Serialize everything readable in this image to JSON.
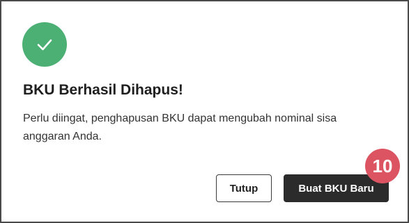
{
  "dialog": {
    "icon": "check-icon",
    "title": "BKU Berhasil Dihapus!",
    "message": "Perlu diingat, penghapusan BKU dapat mengubah nominal sisa anggaran Anda.",
    "close_label": "Tutup",
    "primary_label": "Buat BKU Baru"
  },
  "annotation": {
    "step_number": "10"
  },
  "colors": {
    "success": "#4caf74",
    "primary_button": "#2b2b2b",
    "badge": "#dc5461"
  }
}
